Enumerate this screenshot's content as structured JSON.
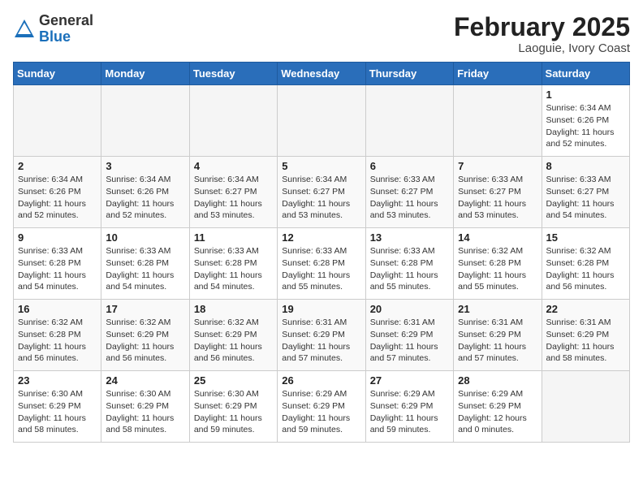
{
  "header": {
    "logo_general": "General",
    "logo_blue": "Blue",
    "month_title": "February 2025",
    "location": "Laoguie, Ivory Coast"
  },
  "weekdays": [
    "Sunday",
    "Monday",
    "Tuesday",
    "Wednesday",
    "Thursday",
    "Friday",
    "Saturday"
  ],
  "weeks": [
    [
      {
        "day": "",
        "info": ""
      },
      {
        "day": "",
        "info": ""
      },
      {
        "day": "",
        "info": ""
      },
      {
        "day": "",
        "info": ""
      },
      {
        "day": "",
        "info": ""
      },
      {
        "day": "",
        "info": ""
      },
      {
        "day": "1",
        "info": "Sunrise: 6:34 AM\nSunset: 6:26 PM\nDaylight: 11 hours\nand 52 minutes."
      }
    ],
    [
      {
        "day": "2",
        "info": "Sunrise: 6:34 AM\nSunset: 6:26 PM\nDaylight: 11 hours\nand 52 minutes."
      },
      {
        "day": "3",
        "info": "Sunrise: 6:34 AM\nSunset: 6:26 PM\nDaylight: 11 hours\nand 52 minutes."
      },
      {
        "day": "4",
        "info": "Sunrise: 6:34 AM\nSunset: 6:27 PM\nDaylight: 11 hours\nand 53 minutes."
      },
      {
        "day": "5",
        "info": "Sunrise: 6:34 AM\nSunset: 6:27 PM\nDaylight: 11 hours\nand 53 minutes."
      },
      {
        "day": "6",
        "info": "Sunrise: 6:33 AM\nSunset: 6:27 PM\nDaylight: 11 hours\nand 53 minutes."
      },
      {
        "day": "7",
        "info": "Sunrise: 6:33 AM\nSunset: 6:27 PM\nDaylight: 11 hours\nand 53 minutes."
      },
      {
        "day": "8",
        "info": "Sunrise: 6:33 AM\nSunset: 6:27 PM\nDaylight: 11 hours\nand 54 minutes."
      }
    ],
    [
      {
        "day": "9",
        "info": "Sunrise: 6:33 AM\nSunset: 6:28 PM\nDaylight: 11 hours\nand 54 minutes."
      },
      {
        "day": "10",
        "info": "Sunrise: 6:33 AM\nSunset: 6:28 PM\nDaylight: 11 hours\nand 54 minutes."
      },
      {
        "day": "11",
        "info": "Sunrise: 6:33 AM\nSunset: 6:28 PM\nDaylight: 11 hours\nand 54 minutes."
      },
      {
        "day": "12",
        "info": "Sunrise: 6:33 AM\nSunset: 6:28 PM\nDaylight: 11 hours\nand 55 minutes."
      },
      {
        "day": "13",
        "info": "Sunrise: 6:33 AM\nSunset: 6:28 PM\nDaylight: 11 hours\nand 55 minutes."
      },
      {
        "day": "14",
        "info": "Sunrise: 6:32 AM\nSunset: 6:28 PM\nDaylight: 11 hours\nand 55 minutes."
      },
      {
        "day": "15",
        "info": "Sunrise: 6:32 AM\nSunset: 6:28 PM\nDaylight: 11 hours\nand 56 minutes."
      }
    ],
    [
      {
        "day": "16",
        "info": "Sunrise: 6:32 AM\nSunset: 6:28 PM\nDaylight: 11 hours\nand 56 minutes."
      },
      {
        "day": "17",
        "info": "Sunrise: 6:32 AM\nSunset: 6:29 PM\nDaylight: 11 hours\nand 56 minutes."
      },
      {
        "day": "18",
        "info": "Sunrise: 6:32 AM\nSunset: 6:29 PM\nDaylight: 11 hours\nand 56 minutes."
      },
      {
        "day": "19",
        "info": "Sunrise: 6:31 AM\nSunset: 6:29 PM\nDaylight: 11 hours\nand 57 minutes."
      },
      {
        "day": "20",
        "info": "Sunrise: 6:31 AM\nSunset: 6:29 PM\nDaylight: 11 hours\nand 57 minutes."
      },
      {
        "day": "21",
        "info": "Sunrise: 6:31 AM\nSunset: 6:29 PM\nDaylight: 11 hours\nand 57 minutes."
      },
      {
        "day": "22",
        "info": "Sunrise: 6:31 AM\nSunset: 6:29 PM\nDaylight: 11 hours\nand 58 minutes."
      }
    ],
    [
      {
        "day": "23",
        "info": "Sunrise: 6:30 AM\nSunset: 6:29 PM\nDaylight: 11 hours\nand 58 minutes."
      },
      {
        "day": "24",
        "info": "Sunrise: 6:30 AM\nSunset: 6:29 PM\nDaylight: 11 hours\nand 58 minutes."
      },
      {
        "day": "25",
        "info": "Sunrise: 6:30 AM\nSunset: 6:29 PM\nDaylight: 11 hours\nand 59 minutes."
      },
      {
        "day": "26",
        "info": "Sunrise: 6:29 AM\nSunset: 6:29 PM\nDaylight: 11 hours\nand 59 minutes."
      },
      {
        "day": "27",
        "info": "Sunrise: 6:29 AM\nSunset: 6:29 PM\nDaylight: 11 hours\nand 59 minutes."
      },
      {
        "day": "28",
        "info": "Sunrise: 6:29 AM\nSunset: 6:29 PM\nDaylight: 12 hours\nand 0 minutes."
      },
      {
        "day": "",
        "info": ""
      }
    ]
  ]
}
